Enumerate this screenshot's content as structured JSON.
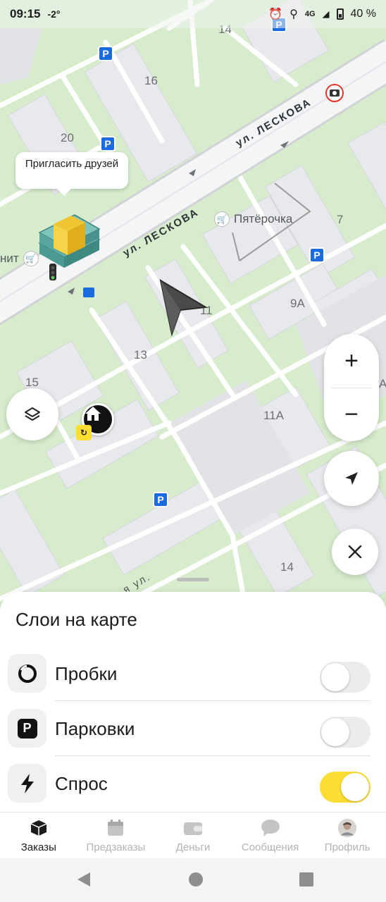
{
  "status_bar": {
    "time": "09:15",
    "temperature": "-2°",
    "network": "4G",
    "battery": "40 %"
  },
  "map": {
    "streets": [
      "ул. ЛЕСКОВА",
      "ул. ЛЕСКОВА",
      "я ул."
    ],
    "house_numbers": [
      "14",
      "16",
      "20",
      "7",
      "9А",
      "11",
      "13",
      "15",
      "11А",
      "14"
    ],
    "pois": {
      "pyaterochka": "Пятёрочка",
      "magnit_partial": "нит"
    },
    "parking_letter": "P",
    "invite_bubble": "Пригласить друзей",
    "edge_fragment": "A"
  },
  "map_controls": {
    "zoom_in": "+",
    "zoom_out": "−"
  },
  "layers_sheet": {
    "title": "Слои на карте",
    "items": [
      {
        "label": "Пробки",
        "icon": "traffic-icon",
        "enabled": false
      },
      {
        "label": "Парковки",
        "icon": "parking-icon",
        "enabled": false
      },
      {
        "label": "Спрос",
        "icon": "lightning-icon",
        "enabled": true
      }
    ]
  },
  "bottom_nav": {
    "items": [
      {
        "label": "Заказы",
        "icon": "orders-icon",
        "active": true
      },
      {
        "label": "Предзаказы",
        "icon": "calendar-icon",
        "active": false
      },
      {
        "label": "Деньги",
        "icon": "wallet-icon",
        "active": false
      },
      {
        "label": "Сообщения",
        "icon": "chat-icon",
        "active": false
      },
      {
        "label": "Профиль",
        "icon": "avatar-icon",
        "active": false
      }
    ]
  },
  "colors": {
    "accent_yellow": "#fcdd33",
    "parking_blue": "#1a6be0",
    "map_green": "#d6eccc",
    "road": "#f4f5f6"
  }
}
